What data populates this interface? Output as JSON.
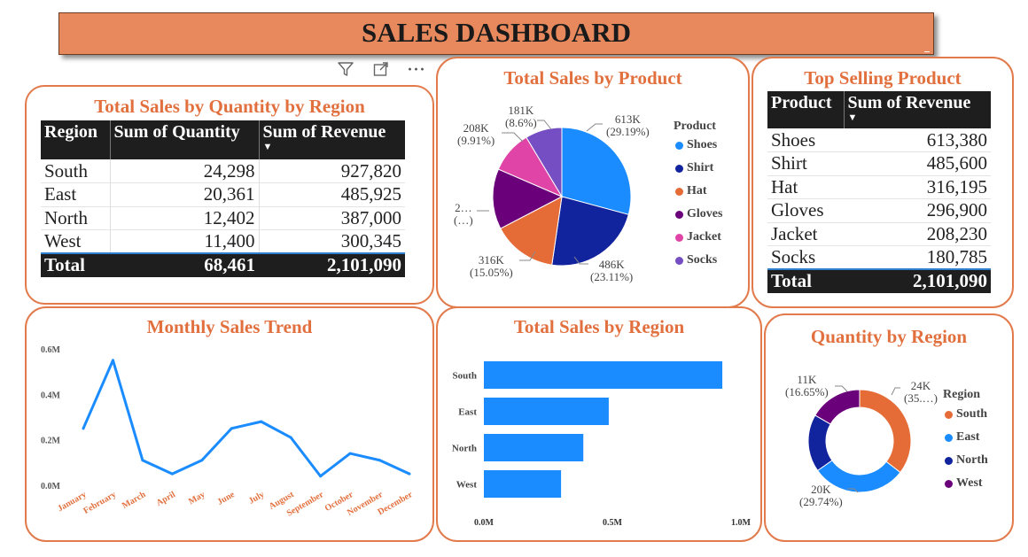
{
  "header": {
    "title": "SALES DASHBOARD"
  },
  "toolbar": {
    "filter_icon": "filter-icon",
    "focus_icon": "focus-mode-icon",
    "more_icon": "more-options-icon",
    "more_glyph": "···"
  },
  "colors": {
    "accent": "#e2703e",
    "header_bg": "#e8895d",
    "blue": "#1a8cff",
    "navy": "#12239e",
    "orange": "#e66c37",
    "purple": "#6b007b",
    "pink": "#e044a7",
    "violet": "#744ec2"
  },
  "region_table": {
    "title": "Total Sales by Quantity by Region",
    "columns": [
      "Region",
      "Sum of Quantity",
      "Sum of Revenue"
    ],
    "sort_glyph": "▼",
    "rows": [
      {
        "region": "South",
        "quantity": "24,298",
        "revenue": "927,820"
      },
      {
        "region": "East",
        "quantity": "20,361",
        "revenue": "485,925"
      },
      {
        "region": "North",
        "quantity": "12,402",
        "revenue": "387,000"
      },
      {
        "region": "West",
        "quantity": "11,400",
        "revenue": "300,345"
      }
    ],
    "total": {
      "label": "Total",
      "quantity": "68,461",
      "revenue": "2,101,090"
    }
  },
  "product_pie": {
    "title": "Total Sales by Product",
    "legend_title": "Product",
    "labels": {
      "shoes": [
        "613K",
        "(29.19%)"
      ],
      "shirt": [
        "486K",
        "(23.11%)"
      ],
      "hat": [
        "316K",
        "(15.05%)"
      ],
      "gloves": [
        "2…",
        "(…)"
      ],
      "jacket": [
        "208K",
        "(9.91%)"
      ],
      "socks": [
        "181K",
        "(8.6%)"
      ]
    }
  },
  "top_product": {
    "title": "Top Selling Product",
    "columns": [
      "Product",
      "Sum of Revenue"
    ],
    "sort_glyph": "▼",
    "rows": [
      {
        "product": "Shoes",
        "revenue": "613,380"
      },
      {
        "product": "Shirt",
        "revenue": "485,600"
      },
      {
        "product": "Hat",
        "revenue": "316,195"
      },
      {
        "product": "Gloves",
        "revenue": "296,900"
      },
      {
        "product": "Jacket",
        "revenue": "208,230"
      },
      {
        "product": "Socks",
        "revenue": "180,785"
      }
    ],
    "total": {
      "label": "Total",
      "revenue": "2,101,090"
    }
  },
  "monthly_trend": {
    "title": "Monthly Sales Trend"
  },
  "region_bar": {
    "title": "Total Sales by Region"
  },
  "quantity_donut": {
    "title": "Quantity by Region",
    "legend_title": "Region",
    "labels": {
      "south": [
        "24K",
        "(35.…)"
      ],
      "east": [
        "20K",
        "(29.74%)"
      ],
      "west": [
        "11K",
        "(16.65%)"
      ]
    }
  },
  "chart_data": [
    {
      "type": "table",
      "title": "Total Sales by Quantity by Region",
      "columns": [
        "Region",
        "Sum of Quantity",
        "Sum of Revenue"
      ],
      "rows": [
        [
          "South",
          24298,
          927820
        ],
        [
          "East",
          20361,
          485925
        ],
        [
          "North",
          12402,
          387000
        ],
        [
          "West",
          11400,
          300345
        ]
      ],
      "total": [
        "Total",
        68461,
        2101090
      ]
    },
    {
      "type": "pie",
      "title": "Total Sales by Product",
      "legend_title": "Product",
      "legend_position": "right",
      "categories": [
        "Shoes",
        "Shirt",
        "Hat",
        "Gloves",
        "Jacket",
        "Socks"
      ],
      "values": [
        613380,
        485600,
        316195,
        296900,
        208230,
        180785
      ],
      "colors": [
        "#1a8cff",
        "#12239e",
        "#e66c37",
        "#6b007b",
        "#e044a7",
        "#744ec2"
      ]
    },
    {
      "type": "table",
      "title": "Top Selling Product",
      "columns": [
        "Product",
        "Sum of Revenue"
      ],
      "rows": [
        [
          "Shoes",
          613380
        ],
        [
          "Shirt",
          485600
        ],
        [
          "Hat",
          316195
        ],
        [
          "Gloves",
          296900
        ],
        [
          "Jacket",
          208230
        ],
        [
          "Socks",
          180785
        ]
      ],
      "total": [
        "Total",
        2101090
      ]
    },
    {
      "type": "line",
      "title": "Monthly Sales Trend",
      "x": [
        "January",
        "February",
        "March",
        "April",
        "May",
        "June",
        "July",
        "August",
        "September",
        "October",
        "November",
        "December"
      ],
      "y": [
        0.25,
        0.55,
        0.11,
        0.05,
        0.11,
        0.25,
        0.28,
        0.21,
        0.04,
        0.14,
        0.11,
        0.05
      ],
      "y_unit": "M",
      "yticks": [
        "0.0M",
        "0.2M",
        "0.4M",
        "0.6M"
      ],
      "ylim": [
        0,
        0.6
      ],
      "color": "#1a8cff",
      "grid": false
    },
    {
      "type": "bar",
      "orientation": "horizontal",
      "title": "Total Sales by Region",
      "categories": [
        "South",
        "East",
        "North",
        "West"
      ],
      "values": [
        927820,
        485925,
        387000,
        300345
      ],
      "xticks": [
        "0.0M",
        "0.5M",
        "1.0M"
      ],
      "xlim": [
        0,
        1000000
      ],
      "color": "#1a8cff"
    },
    {
      "type": "pie",
      "subtype": "donut",
      "title": "Quantity by Region",
      "legend_title": "Region",
      "legend_position": "right",
      "categories": [
        "South",
        "East",
        "North",
        "West"
      ],
      "values": [
        24298,
        20361,
        12402,
        11400
      ],
      "colors": [
        "#e66c37",
        "#1a8cff",
        "#12239e",
        "#6b007b"
      ]
    }
  ]
}
